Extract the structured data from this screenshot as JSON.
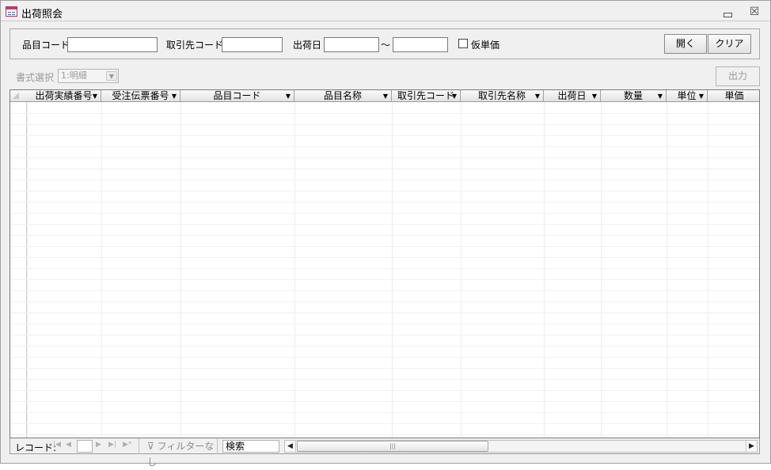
{
  "window": {
    "title": "出荷照会",
    "icon": "form-icon",
    "minimize_icon": "minimize-icon",
    "close_glyph": "☒"
  },
  "filters": {
    "item_code_label": "品目コード",
    "item_code_value": "",
    "customer_code_label": "取引先コード",
    "customer_code_value": "",
    "ship_date_label": "出荷日",
    "ship_date_from": "",
    "range_sep": "～",
    "ship_date_to": "",
    "provisional_price_label": "仮単価",
    "provisional_price_checked": false,
    "open_button": "開く",
    "clear_button": "クリア"
  },
  "format": {
    "label": "書式選択",
    "selected": "1:明細",
    "output_button": "出力"
  },
  "grid": {
    "columns": [
      "出荷実績番号",
      "受注伝票番号",
      "品目コード",
      "品目名称",
      "取引先コード",
      "取引先名称",
      "出荷日",
      "数量",
      "単位",
      "単価"
    ],
    "rows": []
  },
  "status_bar": {
    "record_label": "レコード:",
    "nav_first": "|◀",
    "nav_prev": "◀",
    "nav_next": "▶",
    "nav_last": "▶|",
    "nav_new": "▶*",
    "current_record": "",
    "filter_label": "フィルターなし",
    "search_label": "検索",
    "scroll_left": "◀",
    "scroll_right": "▶",
    "scroll_grip": "|||"
  },
  "colors": {
    "window_bg": "#f0f0f0",
    "border": "#a0a0a0",
    "disabled_text": "#9a9a9a"
  }
}
